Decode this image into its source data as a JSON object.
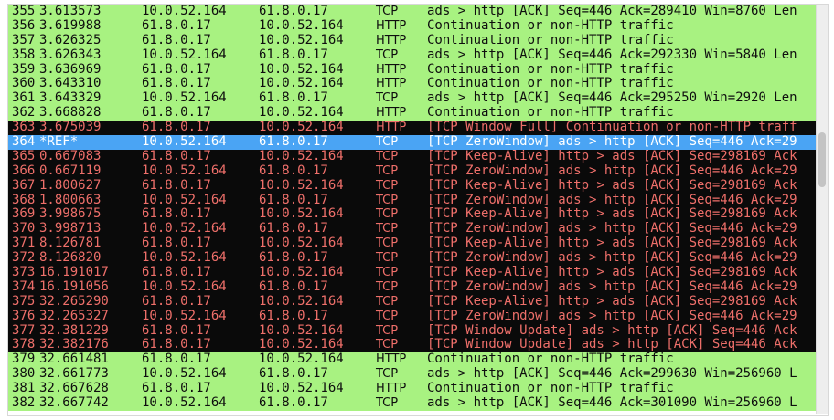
{
  "packet_list": {
    "colors": {
      "normal_bg": "#a8f281",
      "normal_fg": "#0e0e0e",
      "bad_bg": "#0a0a0a",
      "bad_fg": "#ee6f6a",
      "selected_bg": "#4aa4f4",
      "selected_fg": "#ffffff"
    },
    "rows": [
      {
        "no": "355",
        "time": "3.613573",
        "src": "10.0.52.164",
        "dst": "61.8.0.17",
        "proto": "TCP",
        "info": "ads > http [ACK] Seq=446 Ack=289410 Win=8760 Len",
        "style": "green"
      },
      {
        "no": "356",
        "time": "3.619988",
        "src": "61.8.0.17",
        "dst": "10.0.52.164",
        "proto": "HTTP",
        "info": "Continuation or non-HTTP traffic",
        "style": "green"
      },
      {
        "no": "357",
        "time": "3.626325",
        "src": "61.8.0.17",
        "dst": "10.0.52.164",
        "proto": "HTTP",
        "info": "Continuation or non-HTTP traffic",
        "style": "green"
      },
      {
        "no": "358",
        "time": "3.626343",
        "src": "10.0.52.164",
        "dst": "61.8.0.17",
        "proto": "TCP",
        "info": "ads > http [ACK] Seq=446 Ack=292330 Win=5840 Len",
        "style": "green"
      },
      {
        "no": "359",
        "time": "3.636969",
        "src": "61.8.0.17",
        "dst": "10.0.52.164",
        "proto": "HTTP",
        "info": "Continuation or non-HTTP traffic",
        "style": "green"
      },
      {
        "no": "360",
        "time": "3.643310",
        "src": "61.8.0.17",
        "dst": "10.0.52.164",
        "proto": "HTTP",
        "info": "Continuation or non-HTTP traffic",
        "style": "green"
      },
      {
        "no": "361",
        "time": "3.643329",
        "src": "10.0.52.164",
        "dst": "61.8.0.17",
        "proto": "TCP",
        "info": "ads > http [ACK] Seq=446 Ack=295250 Win=2920 Len",
        "style": "green"
      },
      {
        "no": "362",
        "time": "3.668828",
        "src": "61.8.0.17",
        "dst": "10.0.52.164",
        "proto": "HTTP",
        "info": "Continuation or non-HTTP traffic",
        "style": "green"
      },
      {
        "no": "363",
        "time": "3.675039",
        "src": "61.8.0.17",
        "dst": "10.0.52.164",
        "proto": "HTTP",
        "info": "[TCP Window Full] Continuation or non-HTTP traff",
        "style": "black"
      },
      {
        "no": "364",
        "time": "*REF*",
        "src": "10.0.52.164",
        "dst": "61.8.0.17",
        "proto": "TCP",
        "info": "[TCP ZeroWindow] ads > http [ACK] Seq=446 Ack=29",
        "style": "sel"
      },
      {
        "no": "365",
        "time": "0.667083",
        "src": "61.8.0.17",
        "dst": "10.0.52.164",
        "proto": "TCP",
        "info": "[TCP Keep-Alive] http > ads [ACK] Seq=298169 Ack",
        "style": "black"
      },
      {
        "no": "366",
        "time": "0.667119",
        "src": "10.0.52.164",
        "dst": "61.8.0.17",
        "proto": "TCP",
        "info": "[TCP ZeroWindow] ads > http [ACK] Seq=446 Ack=29",
        "style": "black"
      },
      {
        "no": "367",
        "time": "1.800627",
        "src": "61.8.0.17",
        "dst": "10.0.52.164",
        "proto": "TCP",
        "info": "[TCP Keep-Alive] http > ads [ACK] Seq=298169 Ack",
        "style": "black"
      },
      {
        "no": "368",
        "time": "1.800663",
        "src": "10.0.52.164",
        "dst": "61.8.0.17",
        "proto": "TCP",
        "info": "[TCP ZeroWindow] ads > http [ACK] Seq=446 Ack=29",
        "style": "black"
      },
      {
        "no": "369",
        "time": "3.998675",
        "src": "61.8.0.17",
        "dst": "10.0.52.164",
        "proto": "TCP",
        "info": "[TCP Keep-Alive] http > ads [ACK] Seq=298169 Ack",
        "style": "black"
      },
      {
        "no": "370",
        "time": "3.998713",
        "src": "10.0.52.164",
        "dst": "61.8.0.17",
        "proto": "TCP",
        "info": "[TCP ZeroWindow] ads > http [ACK] Seq=446 Ack=29",
        "style": "black"
      },
      {
        "no": "371",
        "time": "8.126781",
        "src": "61.8.0.17",
        "dst": "10.0.52.164",
        "proto": "TCP",
        "info": "[TCP Keep-Alive] http > ads [ACK] Seq=298169 Ack",
        "style": "black"
      },
      {
        "no": "372",
        "time": "8.126820",
        "src": "10.0.52.164",
        "dst": "61.8.0.17",
        "proto": "TCP",
        "info": "[TCP ZeroWindow] ads > http [ACK] Seq=446 Ack=29",
        "style": "black"
      },
      {
        "no": "373",
        "time": "16.191017",
        "src": "61.8.0.17",
        "dst": "10.0.52.164",
        "proto": "TCP",
        "info": "[TCP Keep-Alive] http > ads [ACK] Seq=298169 Ack",
        "style": "black"
      },
      {
        "no": "374",
        "time": "16.191056",
        "src": "10.0.52.164",
        "dst": "61.8.0.17",
        "proto": "TCP",
        "info": "[TCP ZeroWindow] ads > http [ACK] Seq=446 Ack=29",
        "style": "black"
      },
      {
        "no": "375",
        "time": "32.265290",
        "src": "61.8.0.17",
        "dst": "10.0.52.164",
        "proto": "TCP",
        "info": "[TCP Keep-Alive] http > ads [ACK] Seq=298169 Ack",
        "style": "black"
      },
      {
        "no": "376",
        "time": "32.265327",
        "src": "10.0.52.164",
        "dst": "61.8.0.17",
        "proto": "TCP",
        "info": "[TCP ZeroWindow] ads > http [ACK] Seq=446 Ack=29",
        "style": "black"
      },
      {
        "no": "377",
        "time": "32.381229",
        "src": "61.8.0.17",
        "dst": "10.0.52.164",
        "proto": "TCP",
        "info": "[TCP Window Update] ads > http [ACK] Seq=446 Ack",
        "style": "black"
      },
      {
        "no": "378",
        "time": "32.382176",
        "src": "61.8.0.17",
        "dst": "10.0.52.164",
        "proto": "TCP",
        "info": "[TCP Window Update] ads > http [ACK] Seq=446 Ack",
        "style": "black"
      },
      {
        "no": "379",
        "time": "32.661481",
        "src": "61.8.0.17",
        "dst": "10.0.52.164",
        "proto": "HTTP",
        "info": "Continuation or non-HTTP traffic",
        "style": "green"
      },
      {
        "no": "380",
        "time": "32.661773",
        "src": "10.0.52.164",
        "dst": "61.8.0.17",
        "proto": "TCP",
        "info": "ads > http [ACK] Seq=446 Ack=299630 Win=256960 L",
        "style": "green"
      },
      {
        "no": "381",
        "time": "32.667628",
        "src": "61.8.0.17",
        "dst": "10.0.52.164",
        "proto": "HTTP",
        "info": "Continuation or non-HTTP traffic",
        "style": "green"
      },
      {
        "no": "382",
        "time": "32.667742",
        "src": "10.0.52.164",
        "dst": "61.8.0.17",
        "proto": "TCP",
        "info": "ads > http [ACK] Seq=446 Ack=301090 Win=256960 L",
        "style": "green"
      }
    ]
  }
}
